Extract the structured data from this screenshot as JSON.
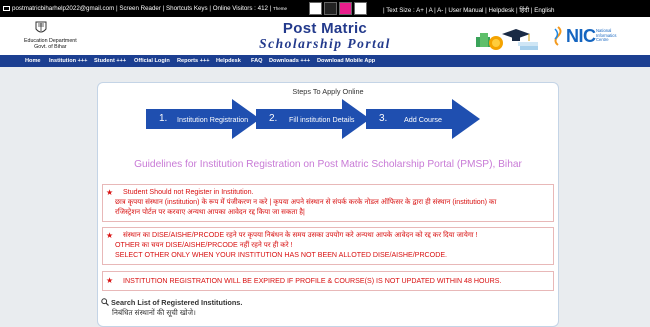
{
  "topbar": {
    "email": "postmatricbiharhelp2022@gmail.com",
    "screen_reader": "Screen Reader",
    "shortcuts": "Shortcuts Keys",
    "visitors": "Online Visitors : 412",
    "theme": "Theme",
    "text_size": "Text Size : A+ | A",
    "a_minus": "A-",
    "user_manual": "User Manual",
    "helpdesk": "Helpdesk",
    "hindi": "हिंदी",
    "english": "English",
    "theme_colors": [
      "#ffffff",
      "#222222",
      "#e91e8c",
      "#ffffff"
    ]
  },
  "header": {
    "dept_line1": "Education Department",
    "dept_line2": "Govt. of Bihar",
    "title1": "Post Matric",
    "title2": "Scholarship Portal",
    "nic": "NIC",
    "nic_sub1": "National",
    "nic_sub2": "Informatics",
    "nic_sub3": "Centre"
  },
  "nav": {
    "items": [
      "Home",
      "Institution +++",
      "Student +++",
      "Official Login",
      "Reports +++",
      "Helpdesk",
      "FAQ",
      "Downloads +++",
      "Download Mobile App"
    ]
  },
  "main": {
    "steps_title": "Steps To Apply Online",
    "steps": [
      {
        "num": "1.",
        "label": "Institution Registration"
      },
      {
        "num": "2.",
        "label": "Fill institution Details"
      },
      {
        "num": "3.",
        "label": "Add Course"
      }
    ],
    "guidelines_title": "Guidelines for Institution Registration on Post Matric Scholarship Portal (PMSP), Bihar",
    "notices": [
      {
        "lines": [
          "Student Should not Register in Institution.",
          "छात्र कृपया संस्थान (institution) के रूप में पंजीकरण न करे | कृपया अपने संस्थान से संपर्क करके नोडल ऑफिसर के द्वारा ही संस्थान (institution) का",
          "रजिस्ट्रेशन पोर्टल पर करवाए अन्यथा आपका आवेदन रद्द किया जा सकता है|"
        ]
      },
      {
        "lines": [
          "संस्थान का DISE/AISHE/PRCODE रहने पर कृपया निबंधन के समय उसका उपयोग करे अन्यथा आपके आवेदन को रद्द कर दिया जायेगा !",
          "OTHER का चयन DISE/AISHE/PRCODE नहीं रहने पर ही करे !",
          "SELECT OTHER ONLY WHEN YOUR INSTITUTION HAS NOT BEEN ALLOTED DISE/AISHE/PRCODE."
        ]
      },
      {
        "lines": [
          "INSTITUTION REGISTRATION WILL BE EXPIRED IF PROFILE & COURSE(S) IS NOT UPDATED WITHIN 48 HOURS."
        ]
      }
    ],
    "search_label": "Search List of Registered Institutions.",
    "search_hindi": "निबंधित संस्थानों की सूची खोजे।"
  }
}
